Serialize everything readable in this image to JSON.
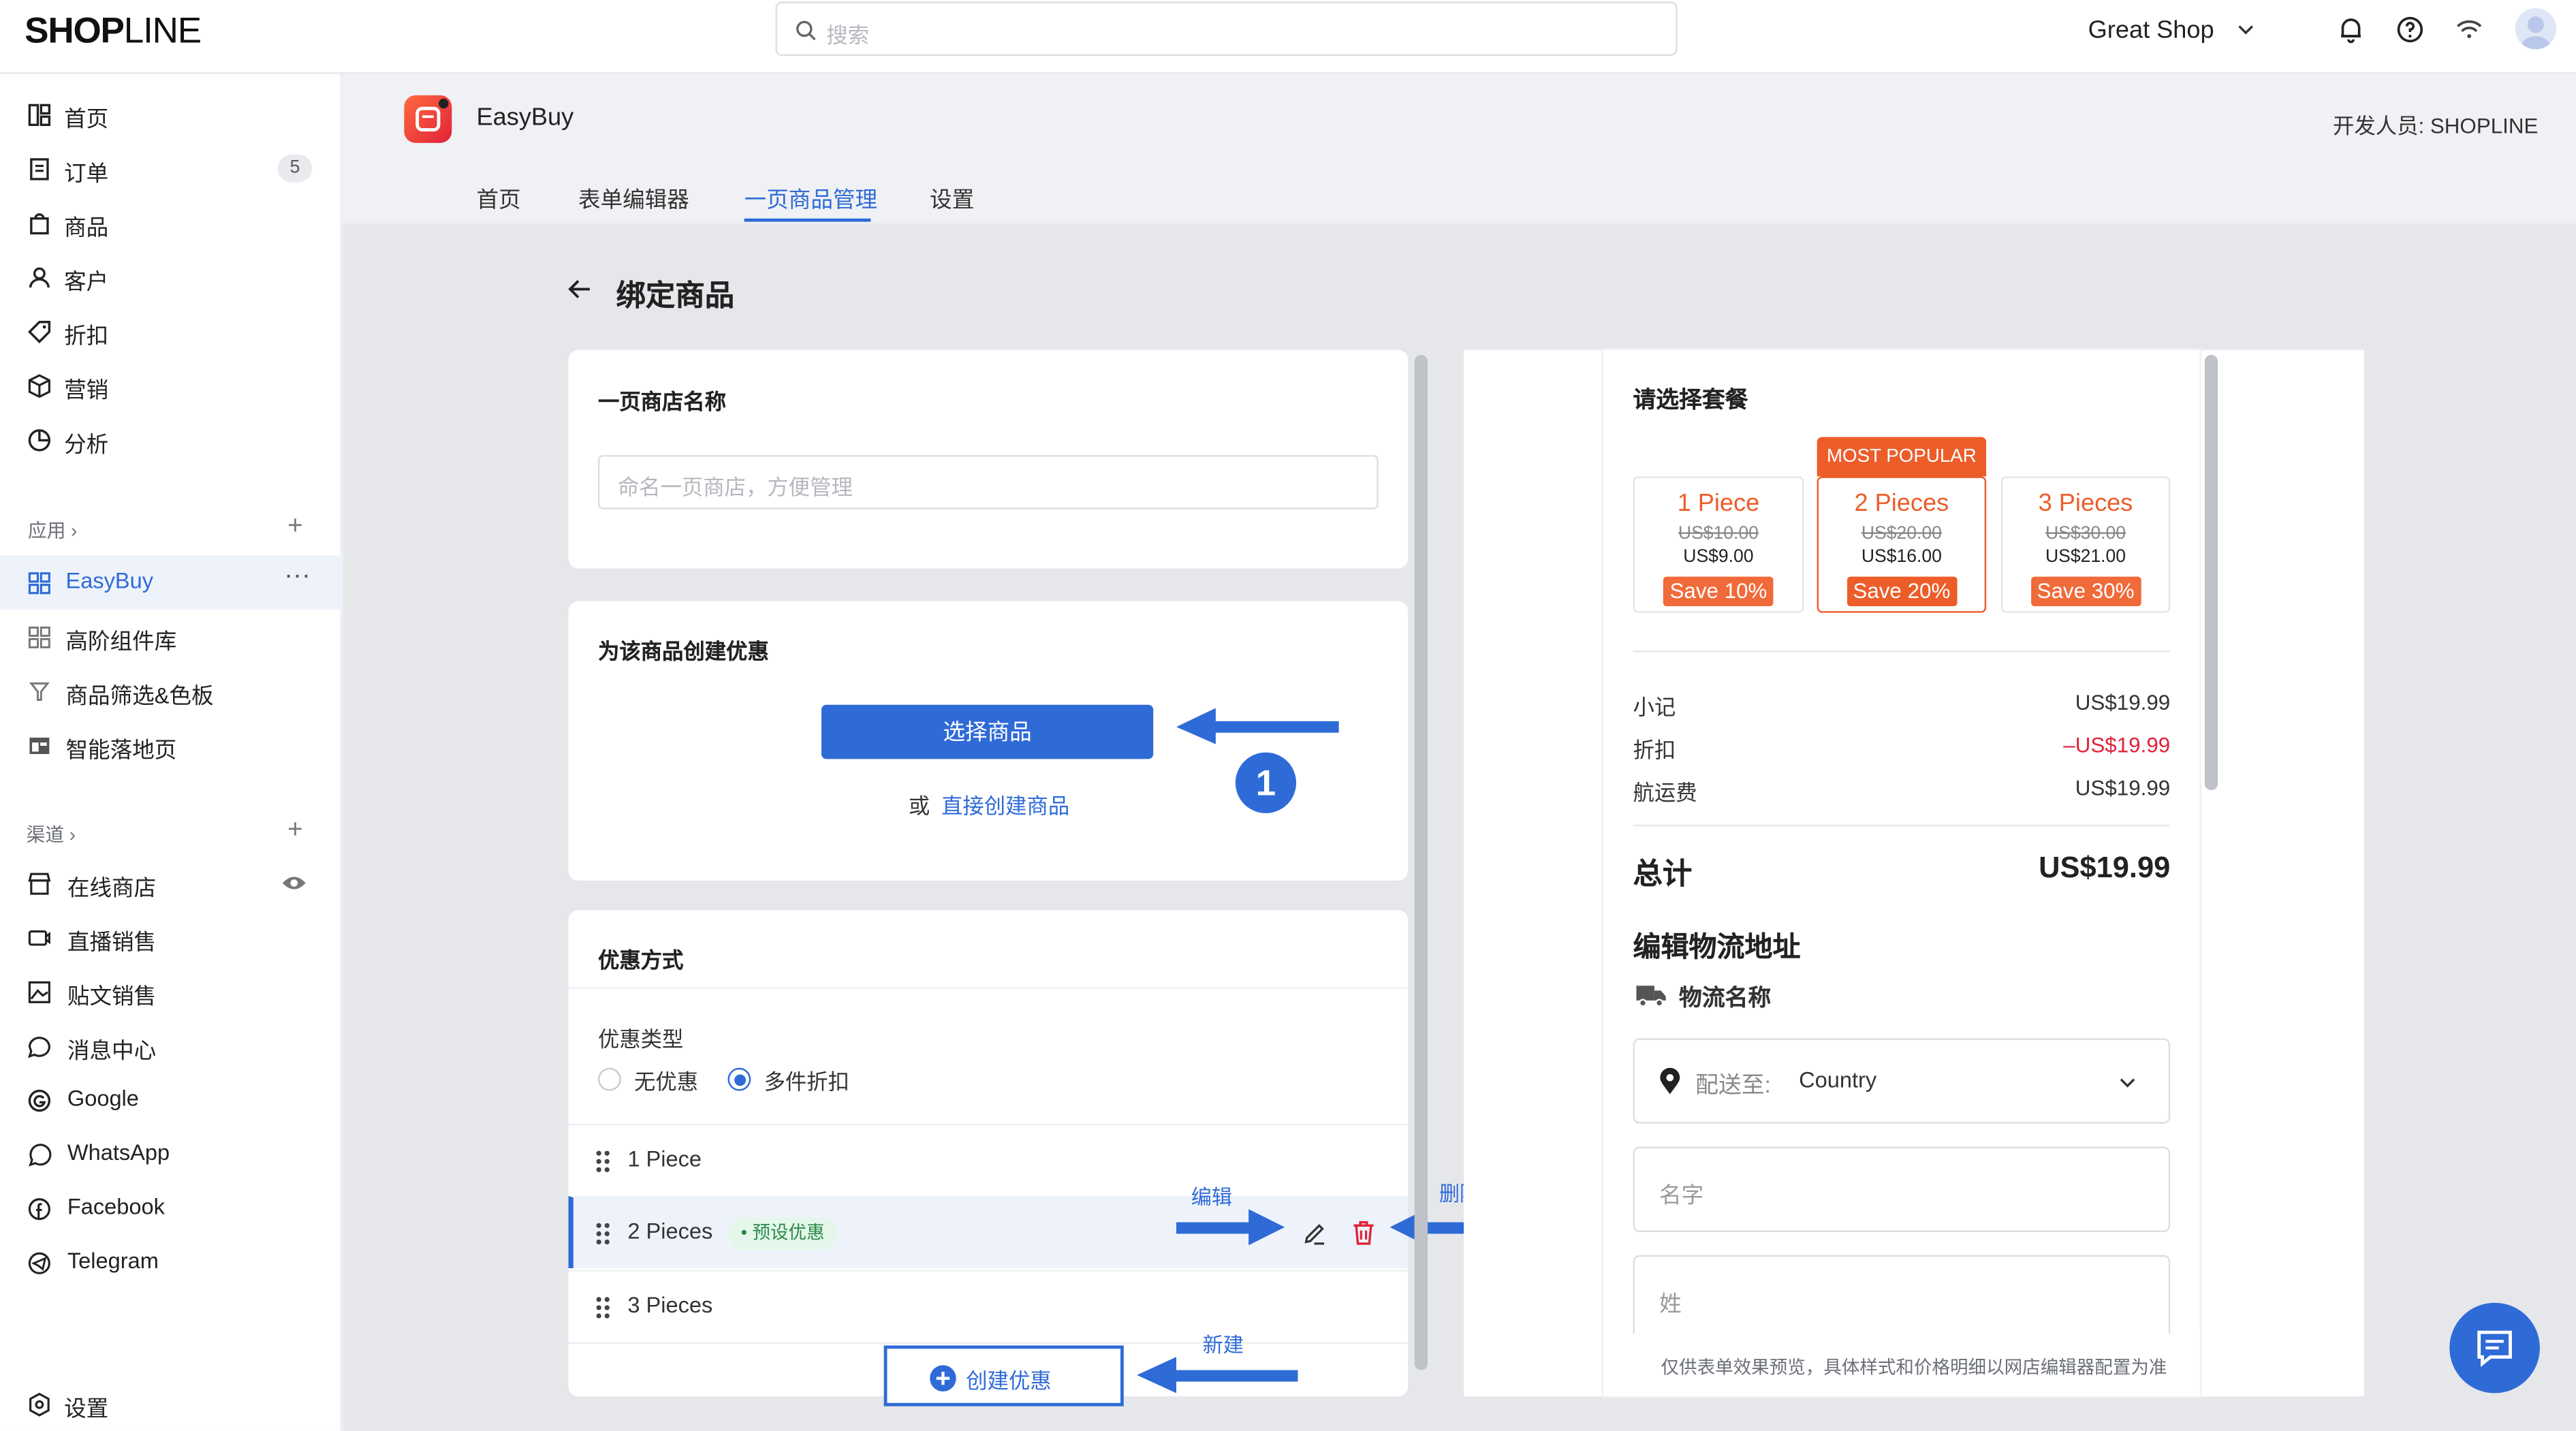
{
  "brand": {
    "logo_bold": "SHOP",
    "logo_thin": "LINE"
  },
  "search": {
    "placeholder": "搜索"
  },
  "shop": {
    "name": "Great Shop"
  },
  "sidebar": {
    "items": [
      {
        "label": "首页"
      },
      {
        "label": "订单",
        "badge": "5"
      },
      {
        "label": "商品"
      },
      {
        "label": "客户"
      },
      {
        "label": "折扣"
      },
      {
        "label": "营销"
      },
      {
        "label": "分析"
      }
    ],
    "apps_title": "应用",
    "apps": [
      {
        "label": "EasyBuy"
      },
      {
        "label": "高阶组件库"
      },
      {
        "label": "商品筛选&色板"
      },
      {
        "label": "智能落地页"
      }
    ],
    "channels_title": "渠道",
    "channels": [
      {
        "label": "在线商店"
      },
      {
        "label": "直播销售"
      },
      {
        "label": "贴文销售"
      },
      {
        "label": "消息中心"
      },
      {
        "label": "Google"
      },
      {
        "label": "WhatsApp"
      },
      {
        "label": "Facebook"
      },
      {
        "label": "Telegram"
      }
    ],
    "settings": "设置"
  },
  "app": {
    "name": "EasyBuy",
    "developer": "开发人员: SHOPLINE",
    "tabs": [
      {
        "label": "首页"
      },
      {
        "label": "表单编辑器"
      },
      {
        "label": "一页商品管理"
      },
      {
        "label": "设置"
      }
    ]
  },
  "page": {
    "title": "绑定商品"
  },
  "store_card": {
    "title": "一页商店名称",
    "placeholder": "命名一页商店，方便管理"
  },
  "discount_card": {
    "title": "为该商品创建优惠",
    "select_button": "选择商品",
    "or": "或",
    "create_link": "直接创建商品",
    "step": "1"
  },
  "offer_card": {
    "title": "优惠方式",
    "type_label": "优惠类型",
    "opt_none": "无优惠",
    "opt_multi": "多件折扣",
    "rows": [
      {
        "label": "1 Piece"
      },
      {
        "label": "2 Pieces",
        "tag": "• 预设优惠"
      },
      {
        "label": "3 Pieces"
      }
    ],
    "create_button": "创建优惠"
  },
  "annotations": {
    "edit": "编辑",
    "delete": "删除",
    "new": "新建"
  },
  "preview": {
    "choose_title": "请选择套餐",
    "most_popular": "MOST POPULAR",
    "packages": [
      {
        "name": "1 Piece",
        "orig": "US$10.00",
        "price": "US$9.00",
        "save": "Save 10%"
      },
      {
        "name": "2 Pieces",
        "orig": "US$20.00",
        "price": "US$16.00",
        "save": "Save 20%"
      },
      {
        "name": "3 Pieces",
        "orig": "US$30.00",
        "price": "US$21.00",
        "save": "Save 30%"
      }
    ],
    "subtotal_label": "小记",
    "subtotal": "US$19.99",
    "discount_label": "折扣",
    "discount": "–US$19.99",
    "shipping_label": "航运费",
    "shipping": "US$19.99",
    "total_label": "总计",
    "total": "US$19.99",
    "address_title": "编辑物流地址",
    "logistics": "物流名称",
    "ship_to": "配送至:",
    "country": "Country",
    "name_ph": "名字",
    "surname_ph": "姓",
    "footnote": "仅供表单效果预览，具体样式和价格明细以网店编辑器配置为准"
  },
  "colors": {
    "accent": "#2f6bd7",
    "orange": "#ec5d2a",
    "discount_red": "#e0223a"
  }
}
